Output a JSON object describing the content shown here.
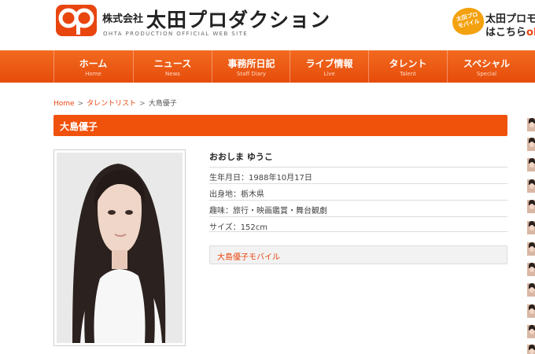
{
  "header": {
    "logo_kaisha": "株式会社",
    "logo_name": "太田プロダクション",
    "logo_subtitle": "OHTA PRODUCTION OFFICIAL WEB SITE",
    "promo_badge": "太田プロ\nモバイル",
    "promo_line1": "太田プロモ",
    "promo_line2_prefix": "はこちら",
    "promo_line2_accent": "ohta"
  },
  "nav": {
    "items": [
      {
        "jp": "ホーム",
        "en": "Home"
      },
      {
        "jp": "ニュース",
        "en": "News"
      },
      {
        "jp": "事務所日記",
        "en": "Staff Diary"
      },
      {
        "jp": "ライブ情報",
        "en": "Live"
      },
      {
        "jp": "タレント",
        "en": "Talent"
      },
      {
        "jp": "スペシャル",
        "en": "Special"
      }
    ]
  },
  "breadcrumb": {
    "home": "Home",
    "sep1": ">",
    "talent_list": "タレントリスト",
    "sep2": ">",
    "current": "大島優子"
  },
  "profile": {
    "title": "大島優子",
    "name_kana": "おおしま ゆうこ",
    "rows": [
      "生年月日：1988年10月17日",
      "出身地：栃木県",
      "趣味：旅行・映画鑑賞・舞台観劇",
      "サイズ：152cm"
    ],
    "mobile_link": "大島優子モバイル"
  },
  "colors": {
    "accent": "#e8450f",
    "nav_top": "#f26a1f",
    "nav_bottom": "#e64c0b",
    "title_bar": "#f0520c"
  }
}
